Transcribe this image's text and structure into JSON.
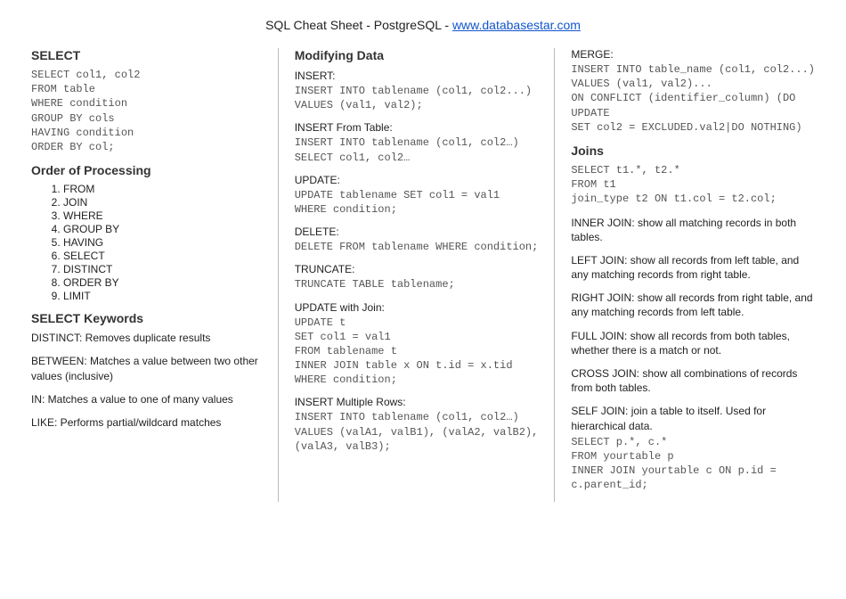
{
  "title_prefix": "SQL Cheat Sheet - PostgreSQL - ",
  "title_link": "www.databasestar.com",
  "col1": {
    "select_heading": "SELECT",
    "select_code": "SELECT col1, col2\nFROM table\nWHERE condition\nGROUP BY cols\nHAVING condition\nORDER BY col;",
    "order_heading": "Order of Processing",
    "order_items": [
      "FROM",
      "JOIN",
      "WHERE",
      "GROUP BY",
      "HAVING",
      "SELECT",
      "DISTINCT",
      "ORDER BY",
      "LIMIT"
    ],
    "keywords_heading": "SELECT Keywords",
    "kw_distinct": "DISTINCT: Removes duplicate results",
    "kw_between": "BETWEEN: Matches a value between two other values (inclusive)",
    "kw_in": "IN: Matches a value to one of many values",
    "kw_like": "LIKE: Performs partial/wildcard matches"
  },
  "col2": {
    "modify_heading": "Modifying Data",
    "insert_label": "INSERT:",
    "insert_code": "INSERT INTO tablename (col1, col2...)\nVALUES (val1, val2);",
    "insert_from_label": "INSERT From Table:",
    "insert_from_code": "INSERT INTO tablename (col1, col2…)\nSELECT col1, col2…",
    "update_label": "UPDATE:",
    "update_code": "UPDATE tablename SET col1 = val1\nWHERE condition;",
    "delete_label": "DELETE:",
    "delete_code": "DELETE FROM tablename WHERE condition;",
    "truncate_label": "TRUNCATE:",
    "truncate_code": "TRUNCATE TABLE tablename;",
    "update_join_label": "UPDATE with Join:",
    "update_join_code": "UPDATE t\nSET col1 = val1\nFROM tablename t\nINNER JOIN table x ON t.id = x.tid\nWHERE condition;",
    "insert_multi_label": "INSERT Multiple Rows:",
    "insert_multi_code": "INSERT INTO tablename (col1, col2…)\nVALUES (valA1, valB1), (valA2, valB2),\n(valA3, valB3);"
  },
  "col3": {
    "merge_label": "MERGE:",
    "merge_code": "INSERT INTO table_name (col1, col2...)\nVALUES (val1, val2)...\nON CONFLICT (identifier_column) (DO\nUPDATE\nSET col2 = EXCLUDED.val2|DO NOTHING)",
    "joins_heading": "Joins",
    "joins_code": "SELECT t1.*, t2.*\nFROM t1\njoin_type t2 ON t1.col = t2.col;",
    "inner_join": "INNER JOIN: show all matching records in both tables.",
    "left_join": "LEFT JOIN: show all records from left table, and any matching records from right table.",
    "right_join": "RIGHT JOIN: show all records from right table, and any matching records from left table.",
    "full_join": "FULL JOIN: show all records from both tables, whether there is a match or not.",
    "cross_join": "CROSS JOIN: show all combinations of records from both tables.",
    "self_join": "SELF JOIN: join a table to itself. Used for hierarchical data.",
    "self_join_code": "SELECT p.*, c.*\nFROM yourtable p\nINNER JOIN yourtable c ON p.id =\nc.parent_id;"
  }
}
